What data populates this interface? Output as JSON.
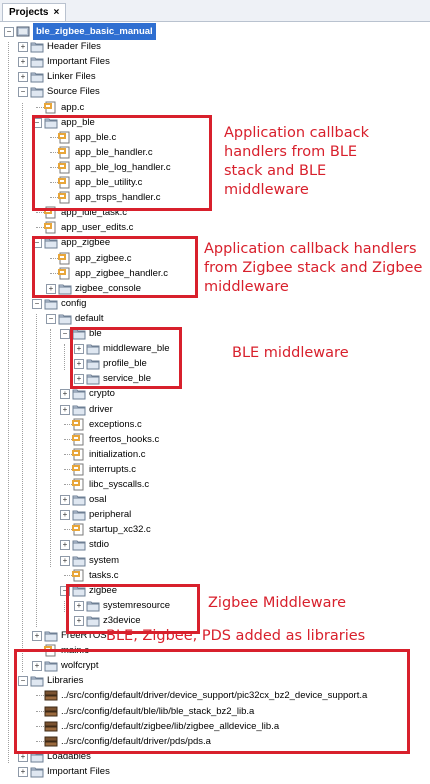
{
  "panel": {
    "tab_label": "Projects",
    "tab_close": "×"
  },
  "colors": {
    "annotation": "#d8202c",
    "selection": "#2f6fd1"
  },
  "tree": [
    {
      "label": "ble_zigbee_basic_manual",
      "depth": 0,
      "type": "project",
      "exp": "-",
      "selected": true
    },
    {
      "label": "Header Files",
      "depth": 1,
      "type": "folder",
      "exp": "+"
    },
    {
      "label": "Important Files",
      "depth": 1,
      "type": "folder",
      "exp": "+"
    },
    {
      "label": "Linker Files",
      "depth": 1,
      "type": "folder",
      "exp": "+"
    },
    {
      "label": "Source Files",
      "depth": 1,
      "type": "folder",
      "exp": "-"
    },
    {
      "label": "app.c",
      "depth": 2,
      "type": "file"
    },
    {
      "label": "app_ble",
      "depth": 2,
      "type": "folder",
      "exp": "-"
    },
    {
      "label": "app_ble.c",
      "depth": 3,
      "type": "file"
    },
    {
      "label": "app_ble_handler.c",
      "depth": 3,
      "type": "file"
    },
    {
      "label": "app_ble_log_handler.c",
      "depth": 3,
      "type": "file"
    },
    {
      "label": "app_ble_utility.c",
      "depth": 3,
      "type": "file"
    },
    {
      "label": "app_trsps_handler.c",
      "depth": 3,
      "type": "file"
    },
    {
      "label": "app_idle_task.c",
      "depth": 2,
      "type": "file"
    },
    {
      "label": "app_user_edits.c",
      "depth": 2,
      "type": "file"
    },
    {
      "label": "app_zigbee",
      "depth": 2,
      "type": "folder",
      "exp": "-"
    },
    {
      "label": "app_zigbee.c",
      "depth": 3,
      "type": "file"
    },
    {
      "label": "app_zigbee_handler.c",
      "depth": 3,
      "type": "file"
    },
    {
      "label": "zigbee_console",
      "depth": 3,
      "type": "folder",
      "exp": "+"
    },
    {
      "label": "config",
      "depth": 2,
      "type": "folder",
      "exp": "-"
    },
    {
      "label": "default",
      "depth": 3,
      "type": "folder",
      "exp": "-"
    },
    {
      "label": "ble",
      "depth": 4,
      "type": "folder",
      "exp": "-"
    },
    {
      "label": "middleware_ble",
      "depth": 5,
      "type": "folder",
      "exp": "+"
    },
    {
      "label": "profile_ble",
      "depth": 5,
      "type": "folder",
      "exp": "+"
    },
    {
      "label": "service_ble",
      "depth": 5,
      "type": "folder",
      "exp": "+"
    },
    {
      "label": "crypto",
      "depth": 4,
      "type": "folder",
      "exp": "+"
    },
    {
      "label": "driver",
      "depth": 4,
      "type": "folder",
      "exp": "+"
    },
    {
      "label": "exceptions.c",
      "depth": 4,
      "type": "file"
    },
    {
      "label": "freertos_hooks.c",
      "depth": 4,
      "type": "file"
    },
    {
      "label": "initialization.c",
      "depth": 4,
      "type": "file"
    },
    {
      "label": "interrupts.c",
      "depth": 4,
      "type": "file"
    },
    {
      "label": "libc_syscalls.c",
      "depth": 4,
      "type": "file"
    },
    {
      "label": "osal",
      "depth": 4,
      "type": "folder",
      "exp": "+"
    },
    {
      "label": "peripheral",
      "depth": 4,
      "type": "folder",
      "exp": "+"
    },
    {
      "label": "startup_xc32.c",
      "depth": 4,
      "type": "file"
    },
    {
      "label": "stdio",
      "depth": 4,
      "type": "folder",
      "exp": "+"
    },
    {
      "label": "system",
      "depth": 4,
      "type": "folder",
      "exp": "+"
    },
    {
      "label": "tasks.c",
      "depth": 4,
      "type": "file"
    },
    {
      "label": "zigbee",
      "depth": 4,
      "type": "folder",
      "exp": "-"
    },
    {
      "label": "systemresource",
      "depth": 5,
      "type": "folder",
      "exp": "+"
    },
    {
      "label": "z3device",
      "depth": 5,
      "type": "folder",
      "exp": "+"
    },
    {
      "label": "FreeRTOS",
      "depth": 2,
      "type": "folder",
      "exp": "+"
    },
    {
      "label": "main.c",
      "depth": 2,
      "type": "file"
    },
    {
      "label": "wolfcrypt",
      "depth": 2,
      "type": "folder",
      "exp": "+"
    },
    {
      "label": "Libraries",
      "depth": 1,
      "type": "folder",
      "exp": "-"
    },
    {
      "label": "../src/config/default/driver/device_support/pic32cx_bz2_device_support.a",
      "depth": 2,
      "type": "lib"
    },
    {
      "label": "../src/config/default/ble/lib/ble_stack_bz2_lib.a",
      "depth": 2,
      "type": "lib"
    },
    {
      "label": "../src/config/default/zigbee/lib/zigbee_alldevice_lib.a",
      "depth": 2,
      "type": "lib"
    },
    {
      "label": "../src/config/default/driver/pds/pds.a",
      "depth": 2,
      "type": "lib"
    },
    {
      "label": "Loadables",
      "depth": 1,
      "type": "folder",
      "exp": "+"
    },
    {
      "label": "Important Files",
      "depth": 1,
      "type": "folder",
      "exp": "+"
    }
  ],
  "annotations": [
    {
      "text": "Application callback handlers from BLE stack and BLE middleware"
    },
    {
      "text": "Application callback handlers from Zigbee stack and Zigbee middleware"
    },
    {
      "text": "BLE middleware"
    },
    {
      "text": "Zigbee Middleware"
    },
    {
      "text": "BLE, Zigbee, PDS added as libraries"
    }
  ]
}
